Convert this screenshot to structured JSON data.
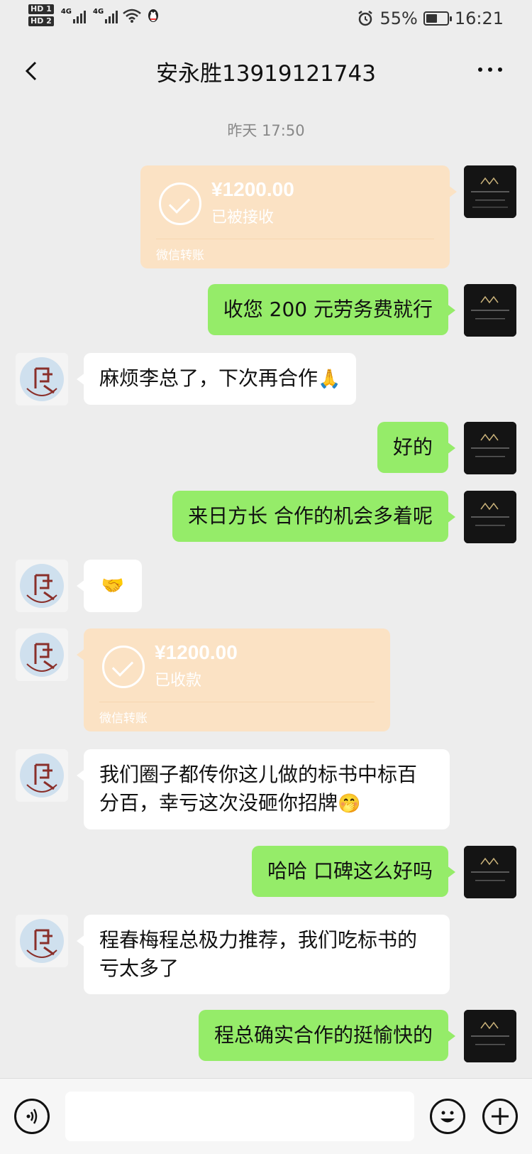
{
  "status_bar": {
    "hd1": "HD 1",
    "hd2": "HD 2",
    "signal1_label": "4G",
    "signal2_label": "4G",
    "battery_percent": "55%",
    "battery_level": 0.55,
    "time": "16:21"
  },
  "header": {
    "title": "安永胜13919121743"
  },
  "chat": {
    "timestamp": "昨天 17:50",
    "transfer_sent": {
      "amount": "¥1200.00",
      "status": "已被接收",
      "footer": "微信转账"
    },
    "transfer_received": {
      "amount": "¥1200.00",
      "status": "已收款",
      "footer": "微信转账"
    },
    "messages": [
      {
        "from": "me",
        "text": "收您 200 元劳务费就行"
      },
      {
        "from": "other",
        "text": "麻烦李总了，下次再合作",
        "emoji": "🙏"
      },
      {
        "from": "me",
        "text": "好的"
      },
      {
        "from": "me",
        "text": "来日方长 合作的机会多着呢"
      },
      {
        "from": "other",
        "text": "",
        "emoji": "🤝"
      },
      {
        "from": "other",
        "text": "我们圈子都传你这儿做的标书中标百分百，幸亏这次没砸你招牌",
        "emoji": "🤭"
      },
      {
        "from": "me",
        "text": "哈哈 口碑这么好吗"
      },
      {
        "from": "other",
        "text": "程春梅程总极力推荐，我们吃标书的亏太多了"
      },
      {
        "from": "me",
        "text": "程总确实合作的挺愉快的"
      }
    ]
  },
  "avatars": {
    "mine_logo": "弘毅标书",
    "other_icon": "seal-logo-icon"
  },
  "colors": {
    "bg": "#ededed",
    "my_bubble": "#95ec69",
    "other_bubble": "#ffffff",
    "transfer": "#fbe2c4"
  },
  "icons": {
    "back": "back-arrow-icon",
    "more": "more-dots-icon",
    "voice": "voice-icon",
    "emoji": "emoji-face-icon",
    "plus": "plus-icon"
  }
}
